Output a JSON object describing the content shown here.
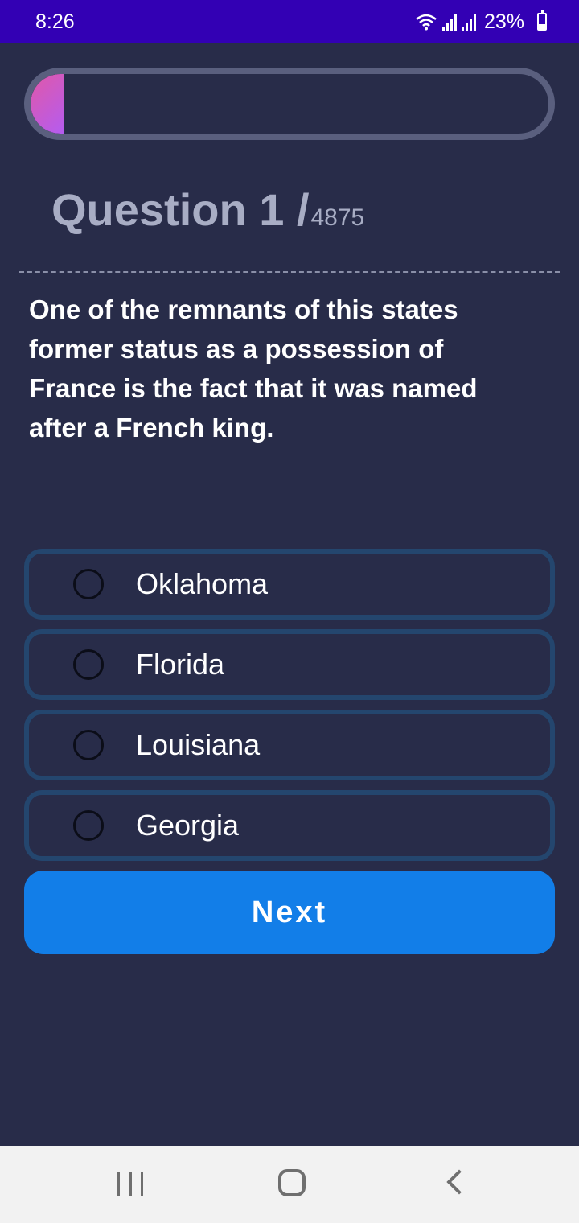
{
  "status_bar": {
    "time": "8:26",
    "battery": "23%",
    "icons": [
      "wifi-icon",
      "signal-icon",
      "signal-icon",
      "battery-icon"
    ]
  },
  "progress": {
    "fraction": 0.065,
    "colors": [
      "#e058a8",
      "#b45cf0"
    ]
  },
  "question": {
    "heading": "Question 1 /",
    "total": "4875",
    "text": "One of the remnants of this states former status as a possession of France is the fact that it was named after a French king."
  },
  "options": [
    {
      "label": "Oklahoma",
      "selected": false
    },
    {
      "label": "Florida",
      "selected": false
    },
    {
      "label": "Louisiana",
      "selected": false
    },
    {
      "label": "Georgia",
      "selected": false
    }
  ],
  "next_button": {
    "label": "Next",
    "color": "#127ee8"
  },
  "nav_bar": {
    "icons": [
      "recents-icon",
      "home-icon",
      "back-icon"
    ]
  },
  "colors": {
    "background": "#282c49",
    "status_bar": "#3300b4",
    "option_border": "#24466e"
  }
}
